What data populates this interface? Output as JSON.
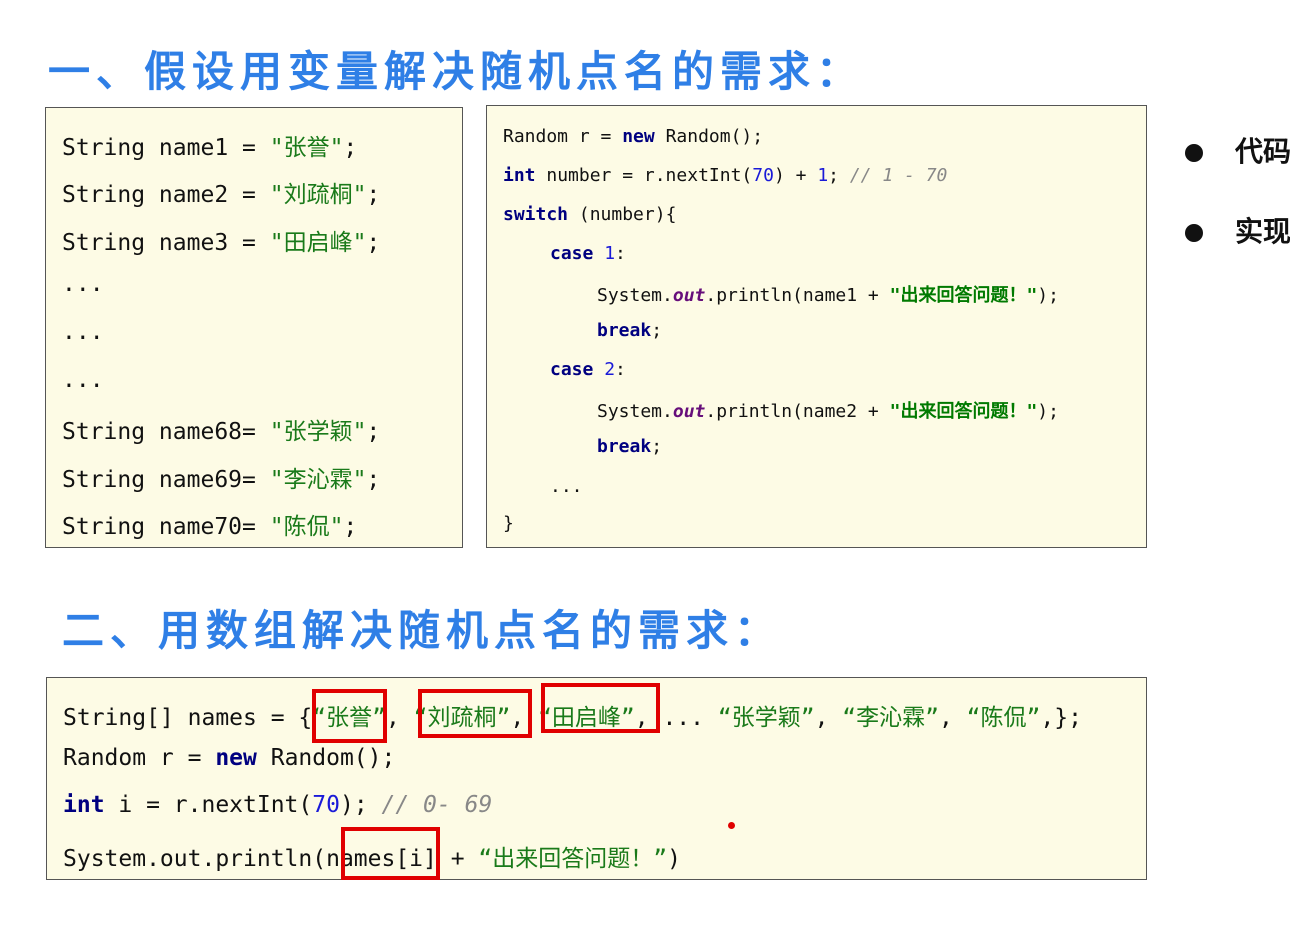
{
  "heading1": "一、假设用变量解决随机点名的需求：",
  "heading2": "二、用数组解决随机点名的需求：",
  "box1": {
    "lines": [
      {
        "prefix": "String name1 = ",
        "str": "\"张誉\"",
        "suffix": ";"
      },
      {
        "prefix": "String name2 = ",
        "str": "\"刘疏桐\"",
        "suffix": ";"
      },
      {
        "prefix": "String name3 = ",
        "str": "\"田启峰\"",
        "suffix": ";"
      },
      {
        "prefix": "...",
        "str": "",
        "suffix": ""
      },
      {
        "prefix": "...",
        "str": "",
        "suffix": ""
      },
      {
        "prefix": "...",
        "str": "",
        "suffix": ""
      },
      {
        "prefix": "String name68= ",
        "str": "\"张学颖\"",
        "suffix": ";"
      },
      {
        "prefix": "String name69= ",
        "str": "\"李沁霖\"",
        "suffix": ";"
      },
      {
        "prefix": "String name70= ",
        "str": "\"陈侃\"",
        "suffix": ";"
      }
    ]
  },
  "box2": {
    "l1a": "Random r = ",
    "l1kw": "new",
    "l1b": " Random();",
    "l2kw": "int",
    "l2a": " number = r.nextInt(",
    "l2n1": "70",
    "l2b": ") + ",
    "l2n2": "1",
    "l2c": "; ",
    "l2cmt": "// 1 - 70",
    "l3kw": "switch",
    "l3a": " (number){",
    "l4kw": "case",
    "l4n": " 1",
    "l4a": ":",
    "l5a": "System.",
    "l5f": "out",
    "l5b": ".println(name1 + ",
    "l5s": "\"出来回答问题！\"",
    "l5c": ");",
    "l6kw": "break",
    "l6a": ";",
    "l7kw": "case",
    "l7n": " 2",
    "l7a": ":",
    "l8a": "System.",
    "l8f": "out",
    "l8b": ".println(name2 + ",
    "l8s": "\"出来回答问题！\"",
    "l8c": ");",
    "l9kw": "break",
    "l9a": ";",
    "l10": "...",
    "l11": "}"
  },
  "box3": {
    "l1a": "String[] names = {",
    "l1s1": "“张誉”",
    "l1c1": ", ",
    "l1s2": "“刘疏桐”",
    "l1c2": ", ",
    "l1s3": "“田启峰”",
    "l1c3": ", ... ",
    "l1s4": "“张学颖”",
    "l1c4": ", ",
    "l1s5": "“李沁霖”",
    "l1c5": ", ",
    "l1s6": "“陈侃”",
    "l1c6": ",};",
    "l2a": "Random r = ",
    "l2kw": "new",
    "l2b": " Random();",
    "l3kw": "int",
    "l3a": " i = r.nextInt(",
    "l3n": "70",
    "l3b": "); ",
    "l3cmt": "// 0- 69",
    "l4a": "System.out.println(names[i] + ",
    "l4s": "“出来回答问题！”",
    "l4b": ")"
  },
  "bullets": [
    "代码",
    "实现"
  ]
}
